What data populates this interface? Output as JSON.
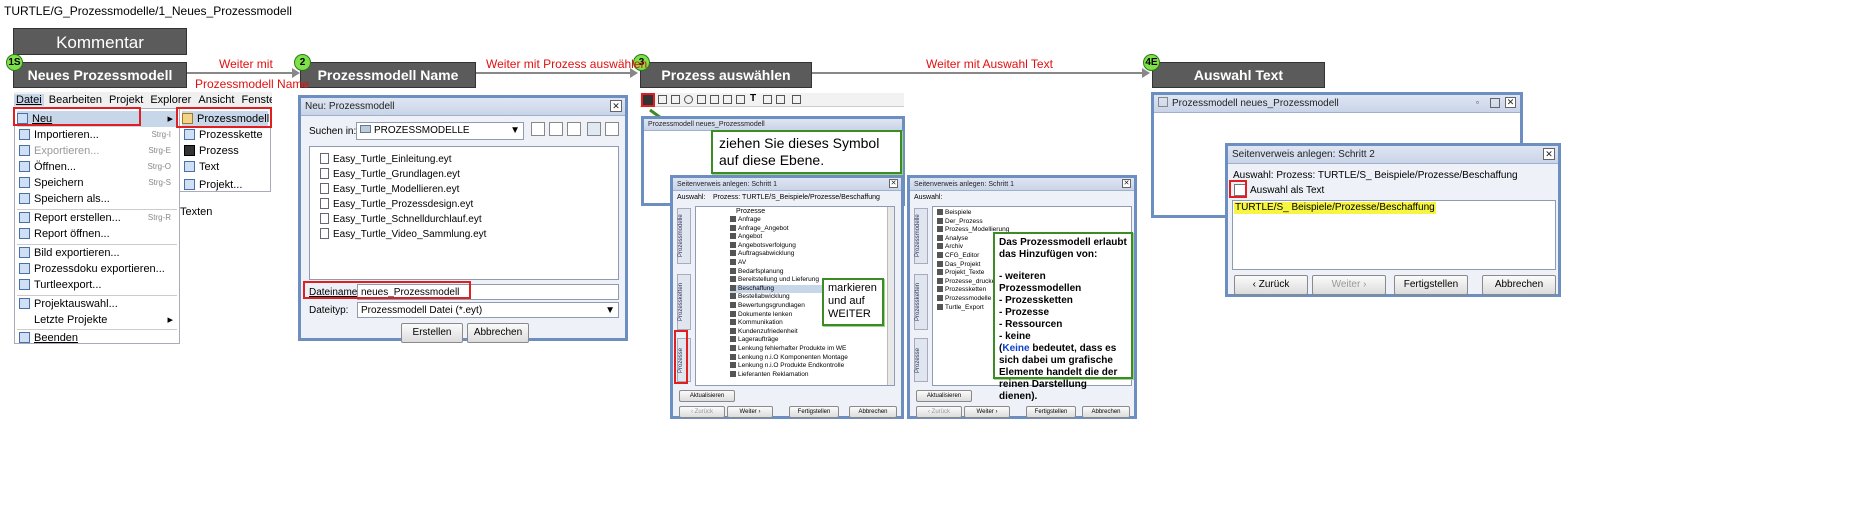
{
  "breadcrumb": "TURTLE/G_Prozessmodelle/1_Neues_Prozessmodell",
  "comment_label": "Kommentar",
  "steps": [
    {
      "badge": "1S",
      "title": "Neues Prozessmodell"
    },
    {
      "badge": "2",
      "title": "Prozessmodell Name"
    },
    {
      "badge": "3",
      "title": "Prozess auswählen"
    },
    {
      "badge": "4E",
      "title": "Auswahl Text"
    }
  ],
  "flows": {
    "f1a": "Weiter mit",
    "f1b": "Prozessmodell Name",
    "f2": "Weiter mit Prozess auswählen",
    "f3": "Weiter mit Auswahl Text"
  },
  "menubar": [
    "Datei",
    "Bearbeiten",
    "Projekt",
    "Explorer",
    "Ansicht",
    "Fenster",
    "F"
  ],
  "file_menu": [
    {
      "label": "Neu",
      "shortcut": ""
    },
    {
      "label": "Importieren...",
      "shortcut": "Strg-I"
    },
    {
      "label": "Exportieren...",
      "shortcut": "Strg-E"
    },
    {
      "label": "Öffnen...",
      "shortcut": "Strg-O"
    },
    {
      "label": "Speichern",
      "shortcut": "Strg-S"
    },
    {
      "label": "Speichern als...",
      "shortcut": ""
    },
    {
      "label": "Report erstellen...",
      "shortcut": "Strg-R"
    },
    {
      "label": "Report öffnen...",
      "shortcut": ""
    },
    {
      "label": "Bild exportieren...",
      "shortcut": ""
    },
    {
      "label": "Prozessdoku exportieren...",
      "shortcut": ""
    },
    {
      "label": "Turtleexport...",
      "shortcut": ""
    },
    {
      "label": "Projektauswahl...",
      "shortcut": ""
    },
    {
      "label": "Letzte Projekte",
      "shortcut": ""
    },
    {
      "label": "Beenden",
      "shortcut": ""
    }
  ],
  "submenu": [
    "Prozessmodell",
    "Prozesskette",
    "Prozess",
    "Text",
    "Projekt..."
  ],
  "submenu_extra": "Texten",
  "dialog2": {
    "title": "Neu: Prozessmodell",
    "lookin_label": "Suchen in:",
    "lookin_value": "PROZESSMODELLE",
    "files": [
      "Easy_Turtle_Einleitung.eyt",
      "Easy_Turtle_Grundlagen.eyt",
      "Easy_Turtle_Modellieren.eyt",
      "Easy_Turtle_Prozessdesign.eyt",
      "Easy_Turtle_Schnelldurchlauf.eyt",
      "Easy_Turtle_Video_Sammlung.eyt"
    ],
    "filename_label": "Dateiname:",
    "filename_value": "neues_Prozessmodell",
    "filetype_label": "Dateityp:",
    "filetype_value": "Prozessmodell Datei (*.eyt)",
    "create": "Erstellen",
    "cancel": "Abbrechen"
  },
  "step3": {
    "model_window_title": "Prozessmodell neues_Prozessmodell",
    "drag_note": "ziehen Sie dieses Symbol auf diese Ebene.",
    "dialog_title": "Seitenverweis anlegen: Schritt 1",
    "selection_label": "Auswahl:",
    "selection_value": "Prozess: TURTLE/S_Beispiele/Prozesse/Beschaffung",
    "tree_root": "Prozesse",
    "tree_items": [
      "Anfrage",
      "Anfrage_Angebot",
      "Angebot",
      "Angebotsverfolgung",
      "Auftragsabwicklung",
      "AV",
      "Bedarfsplanung",
      "Bereitstellung und Lieferung",
      "Beschaffung",
      "Bestellabwicklung",
      "Bewertungsgrundlagen",
      "Dokumente lenken",
      "Kommunikation",
      "Kundenzufriedenheit",
      "Lageraufträge",
      "Lenkung fehlerhafter Produkte im WE",
      "Lenkung n.i.O Komponenten Montage",
      "Lenkung n.i.O Produkte Endkontrolle",
      "Lieferanten Reklamation"
    ],
    "vtabs": [
      "Prozessmodelle",
      "Prozessketten",
      "Prozesse"
    ],
    "mark_note": "markieren und auf WEITER",
    "refresh": "Aktualisieren",
    "back": "‹ Zurück",
    "next": "Weiter ›",
    "finish": "Fertigstellen",
    "cancel": "Abbrechen"
  },
  "step3b": {
    "dialog_title": "Seitenverweis anlegen: Schritt 1",
    "selection_label": "Auswahl:",
    "tree_items": [
      "Beispiele",
      "Der_Prozess",
      "Prozess_Modellierung",
      "Analyse",
      "Archiv",
      "CFG_Editor",
      "Das_Projekt",
      "Projekt_Texte",
      "Prozesse_drucken",
      "Prozessketten",
      "Prozessmodelle",
      "Turtle_Export"
    ],
    "info_title": "Das Prozessmodell erlaubt das Hinzufügen von:",
    "info_items": [
      "- weiteren Prozessmodellen",
      "- Prozessketten",
      "- Prozesse",
      "- Ressourcen",
      "- keine"
    ],
    "info_keine": "Keine",
    "info_rest": " bedeutet, dass es sich dabei um grafische Elemente handelt die der reinen Darstellung dienen).",
    "refresh": "Aktualisieren",
    "back": "‹ Zurück",
    "next": "Weiter ›",
    "finish": "Fertigstellen",
    "cancel": "Abbrechen"
  },
  "step4": {
    "model_window_title": "Prozessmodell neues_Prozessmodell",
    "dialog_title": "Seitenverweis anlegen: Schritt 2",
    "selection": "Auswahl: Prozess: TURTLE/S_ Beispiele/Prozesse/Beschaffung",
    "checkbox_label": "Auswahl als Text",
    "text_value": "TURTLE/S_ Beispiele/Prozesse/Beschaffung",
    "back": "‹ Zurück",
    "next": "Weiter ›",
    "finish": "Fertigstellen",
    "cancel": "Abbrechen"
  },
  "colors": {
    "header": "#5b5b5b",
    "badge": "#7ee04a",
    "flow_text": "#e01010",
    "highlight": "#e02020",
    "note_border": "#3c8c26",
    "window_border": "#6d8ec0",
    "text_highlight": "#f5f542"
  }
}
